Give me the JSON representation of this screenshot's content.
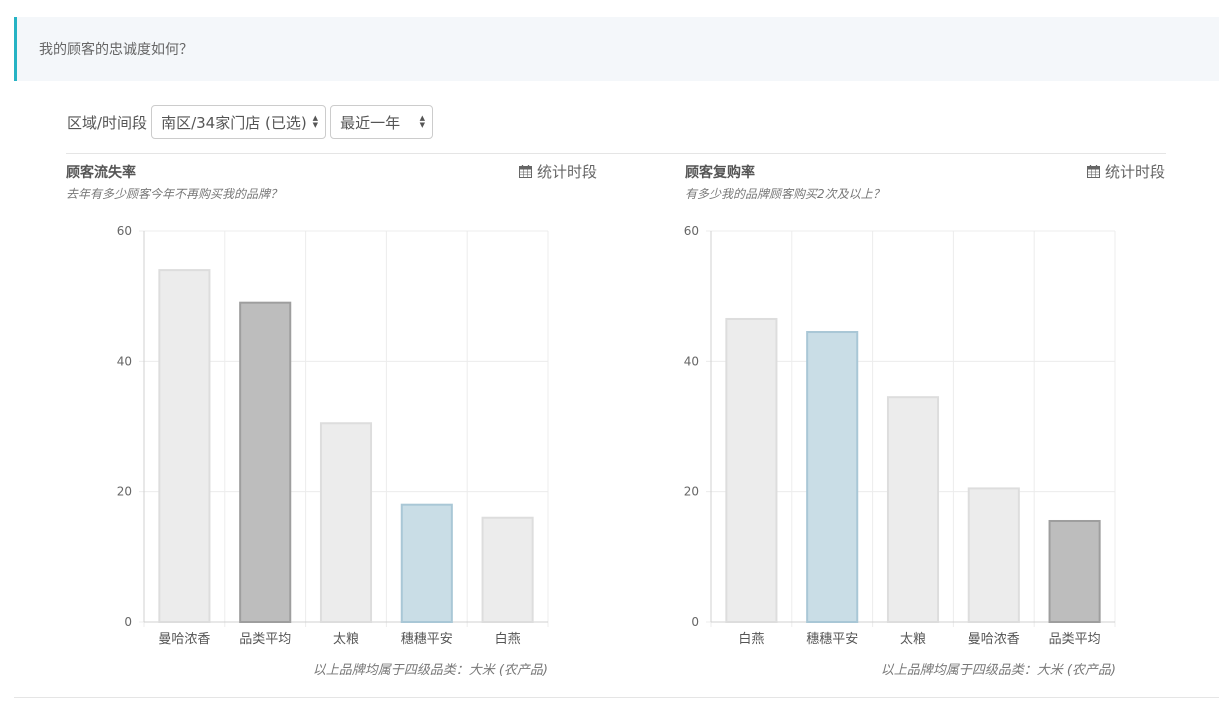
{
  "question": "我的顾客的忠诚度如何？",
  "filters": {
    "label": "区域/时间段",
    "region_selected": "南区/34家门店 (已选)",
    "period_selected": "最近一年"
  },
  "panels": [
    {
      "title": "顾客流失率",
      "subtitle": "去年有多少顾客今年不再购买我的品牌？",
      "period_label": "统计时段",
      "note": "以上品牌均属于四级品类：大米 (农产品)"
    },
    {
      "title": "顾客复购率",
      "subtitle": "有多少我的品牌顾客购买2次及以上？",
      "period_label": "统计时段",
      "note": "以上品牌均属于四级品类：大米 (农产品)"
    }
  ],
  "colors": {
    "accent": "#26b3c4",
    "bar_default_fill": "#ececec",
    "bar_default_stroke": "#dddddd",
    "bar_average_fill": "#bdbdbd",
    "bar_average_stroke": "#9e9e9e",
    "bar_highlight_fill": "#c9dde6",
    "bar_highlight_stroke": "#a9c7d6"
  },
  "chart_data": [
    {
      "type": "bar",
      "categories": [
        "曼哈浓香",
        "品类平均",
        "太粮",
        "穗穗平安",
        "白燕"
      ],
      "values": [
        54,
        49,
        30.5,
        18,
        16
      ],
      "styles": [
        "default",
        "average",
        "default",
        "highlight",
        "default"
      ],
      "ylim": [
        0,
        60
      ],
      "yticks": [
        0,
        20,
        40,
        60
      ],
      "grid": true,
      "title": "",
      "xlabel": "",
      "ylabel": ""
    },
    {
      "type": "bar",
      "categories": [
        "白燕",
        "穗穗平安",
        "太粮",
        "曼哈浓香",
        "品类平均"
      ],
      "values": [
        46.5,
        44.5,
        34.5,
        20.5,
        15.5
      ],
      "styles": [
        "default",
        "highlight",
        "default",
        "default",
        "average"
      ],
      "ylim": [
        0,
        60
      ],
      "yticks": [
        0,
        20,
        40,
        60
      ],
      "grid": true,
      "title": "",
      "xlabel": "",
      "ylabel": ""
    }
  ]
}
